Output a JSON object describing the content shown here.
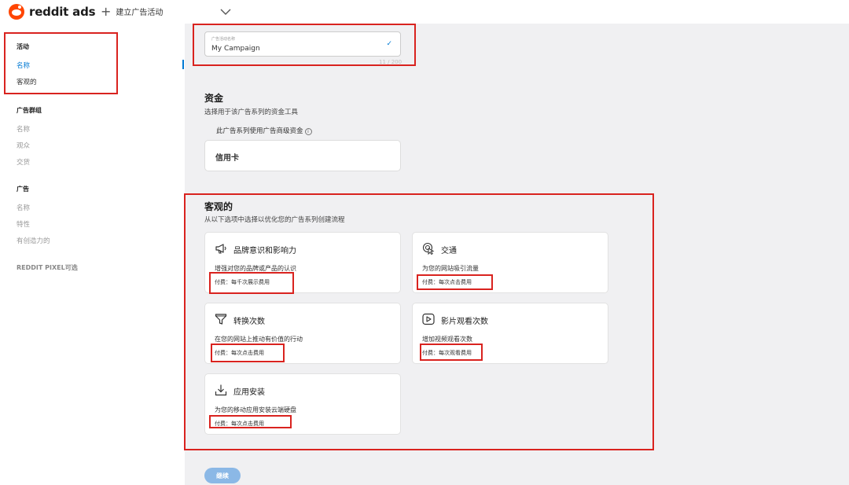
{
  "header": {
    "logo_text": "reddit ads",
    "new_campaign_label": "建立广告活动"
  },
  "sidebar": {
    "sections": [
      {
        "title": "活动",
        "items": [
          "名称",
          "客观的"
        ]
      },
      {
        "title": "广告群组",
        "items": [
          "名称",
          "观众",
          "交货"
        ]
      },
      {
        "title": "广告",
        "items": [
          "名称",
          "特性",
          "有创造力的"
        ]
      }
    ],
    "pixel_label": "REDDIT PIXEL可选"
  },
  "campaign_name": {
    "label": "广告活动名称",
    "value": "My Campaign",
    "counter": "11 / 200"
  },
  "funding": {
    "title": "资金",
    "subtitle": "选择用于该广告系列的资金工具",
    "note": "此广告系列使用广告商级资金",
    "info_glyph": "i",
    "option": "信用卡"
  },
  "objective": {
    "title": "客观的",
    "subtitle": "从以下选项中选择以优化您的广告系列创建流程",
    "cards": [
      {
        "icon": "megaphone-icon",
        "title": "品牌意识和影响力",
        "desc": "增强对您的品牌或产品的认识",
        "pay": "付费：每千次展示费用"
      },
      {
        "icon": "target-cursor-icon",
        "title": "交通",
        "desc": "为您的网站吸引流量",
        "pay": "付费：每次点击费用"
      },
      {
        "icon": "funnel-icon",
        "title": "转换次数",
        "desc": "在您的网站上推动有价值的行动",
        "pay": "付费：每次点击费用"
      },
      {
        "icon": "play-icon",
        "title": "影片观看次数",
        "desc": "增加视频观看次数",
        "pay": "付费：每次观看费用"
      },
      {
        "icon": "download-icon",
        "title": "应用安装",
        "desc": "为您的移动应用安装云端硬盘",
        "pay": "付费：每次点击费用"
      }
    ]
  },
  "continue_label": "继续",
  "colors": {
    "brand": "#ff4500",
    "accent": "#0079d3",
    "highlight": "#d9231f"
  }
}
